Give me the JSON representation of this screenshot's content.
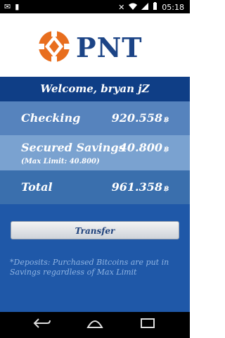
{
  "status_bar": {
    "time": "05:18",
    "left_icons": [
      "notification-icon",
      "notification-icon"
    ],
    "right_icons": [
      "no-sim-icon",
      "wifi-icon",
      "signal-icon",
      "battery-icon"
    ]
  },
  "brand": {
    "name": "PNT",
    "colors": {
      "primary": "#1c4486",
      "accent": "#e86e1e"
    }
  },
  "welcome": {
    "text": "Welcome, bryan jZ"
  },
  "accounts": [
    {
      "label": "Checking",
      "amount": "920.558",
      "currency": "฿"
    },
    {
      "label": "Secured Savings",
      "amount": "40.800",
      "currency": "฿",
      "sub": "(Max Limit: 40.800)"
    },
    {
      "label": "Total",
      "amount": "961.358",
      "currency": "฿"
    }
  ],
  "actions": {
    "transfer_label": "Transfer"
  },
  "note": "*Deposits: Purchased Bitcoins are put in Savings regardless of Max Limit",
  "nav": {
    "icons": [
      "back-icon",
      "home-icon",
      "recent-apps-icon"
    ]
  }
}
